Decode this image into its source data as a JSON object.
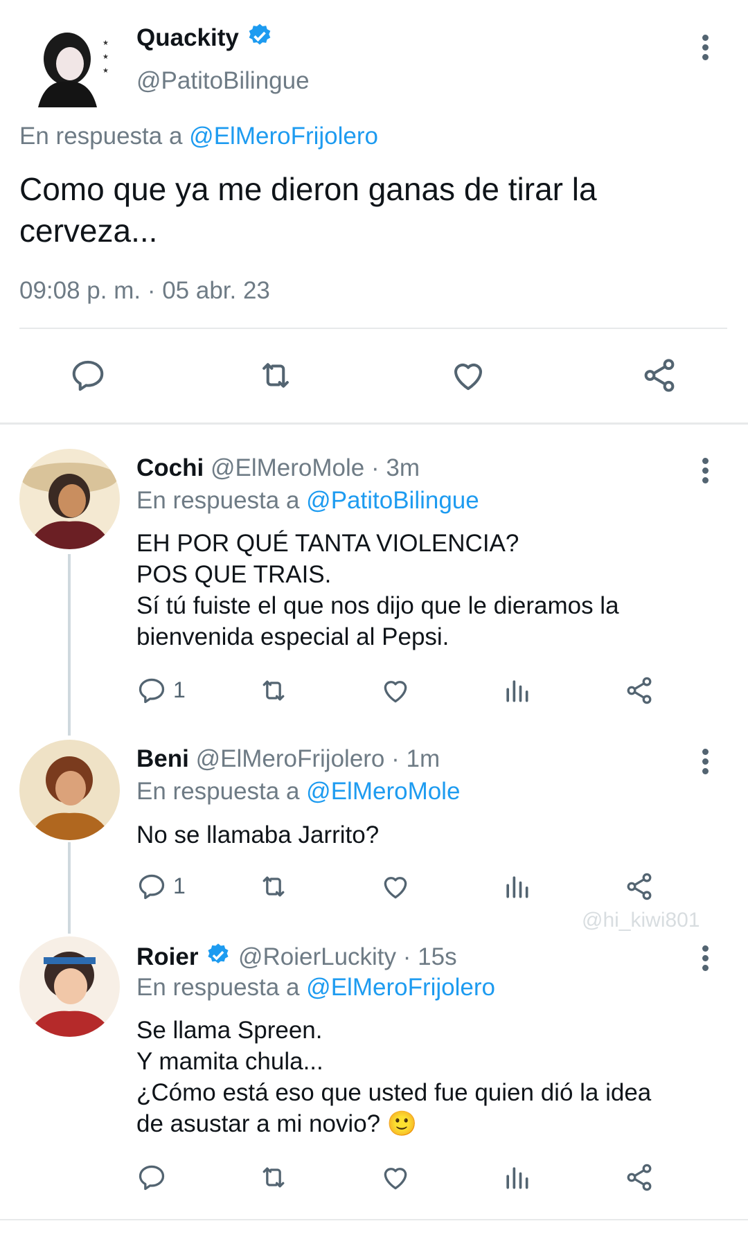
{
  "main_tweet": {
    "name": "Quackity",
    "handle": "@PatitoBilingue",
    "reply_prefix": "En respuesta a",
    "reply_to": "@ElMeroFrijolero",
    "text": "Como que ya me dieron ganas de tirar la\ncerveza...",
    "timestamp": "09:08 p. m. · 05 abr. 23",
    "verified": true,
    "actions": [
      "reply-icon",
      "retweet-icon",
      "like-icon",
      "share-icon"
    ]
  },
  "replies": [
    {
      "name": "Cochi",
      "handle": "@ElMeroMole",
      "time": "· 3m",
      "reply_prefix": "En respuesta a",
      "reply_to": "@PatitoBilingue",
      "text": "EH POR QUÉ TANTA VIOLENCIA?\nPOS QUE TRAIS.\nSí tú fuiste el que nos dijo que le dieramos la\nbienvenida especial al Pepsi.",
      "reply_count": "1",
      "verified": false
    },
    {
      "name": "Beni",
      "handle": "@ElMeroFrijolero",
      "time": "· 1m",
      "reply_prefix": "En respuesta a",
      "reply_to": "@ElMeroMole",
      "text": "No se llamaba Jarrito?",
      "reply_count": "1",
      "verified": false
    },
    {
      "name": "Roier",
      "handle": "@RoierLuckity",
      "time": "· 15s",
      "reply_prefix": "En respuesta a",
      "reply_to": "@ElMeroFrijolero",
      "text": "Se llama Spreen.\nY mamita chula...\n¿Cómo está eso que usted fue quien dió la idea\nde asustar a mi novio? 🙂",
      "reply_count": "",
      "verified": true
    }
  ],
  "watermark": "@hi_kiwi801",
  "colors": {
    "link": "#1d9bf0",
    "muted": "#6e7b85",
    "icon": "#536471",
    "verified": "#1d9bf0"
  }
}
